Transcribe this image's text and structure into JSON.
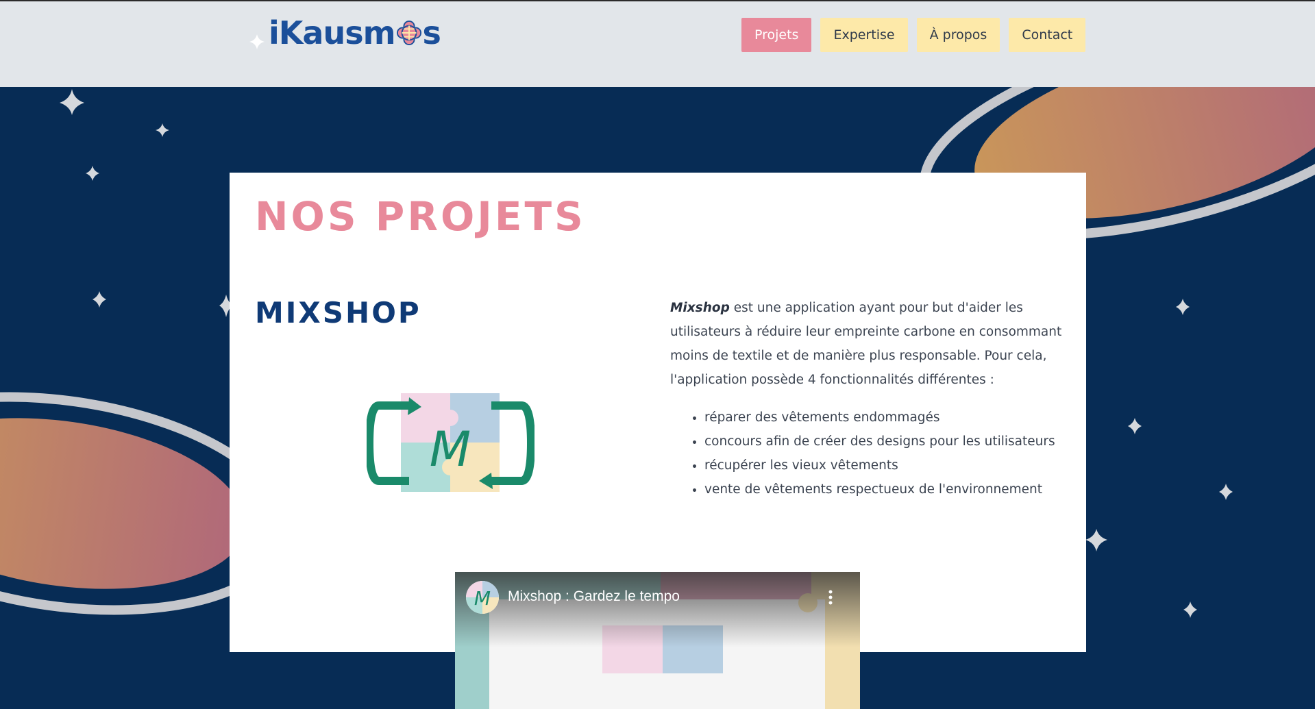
{
  "header": {
    "logo_text": "iKausmos",
    "nav": [
      {
        "label": "Projets",
        "active": true
      },
      {
        "label": "Expertise",
        "active": false
      },
      {
        "label": "À propos",
        "active": false
      },
      {
        "label": "Contact",
        "active": false
      }
    ]
  },
  "main": {
    "title": "NOS PROJETS",
    "project": {
      "name": "MIXSHOP",
      "logo_letter": "M",
      "description_brand": "Mixshop",
      "description_text": " est une application ayant pour but d'aider les utilisateurs à réduire leur empreinte carbone en consommant moins de textile et de manière plus responsable. Pour cela, l'application possède 4 fonctionnalités différentes :",
      "features": [
        "réparer des vêtements endommagés",
        "concours afin de créer des designs pour les utilisateurs",
        "récupérer les vieux vêtements",
        "vente de vêtements respectueux de l'environnement"
      ],
      "video": {
        "title": "Mixshop : Gardez le tempo",
        "channel_letter": "M"
      }
    }
  },
  "colors": {
    "background": "#072c55",
    "header_bg": "#e2e6ea",
    "nav_active": "#e8899a",
    "nav_default": "#fde9a9",
    "title_pink": "#e8899a",
    "subtitle_navy": "#0f3a76",
    "logo_green": "#1a8a6a"
  }
}
